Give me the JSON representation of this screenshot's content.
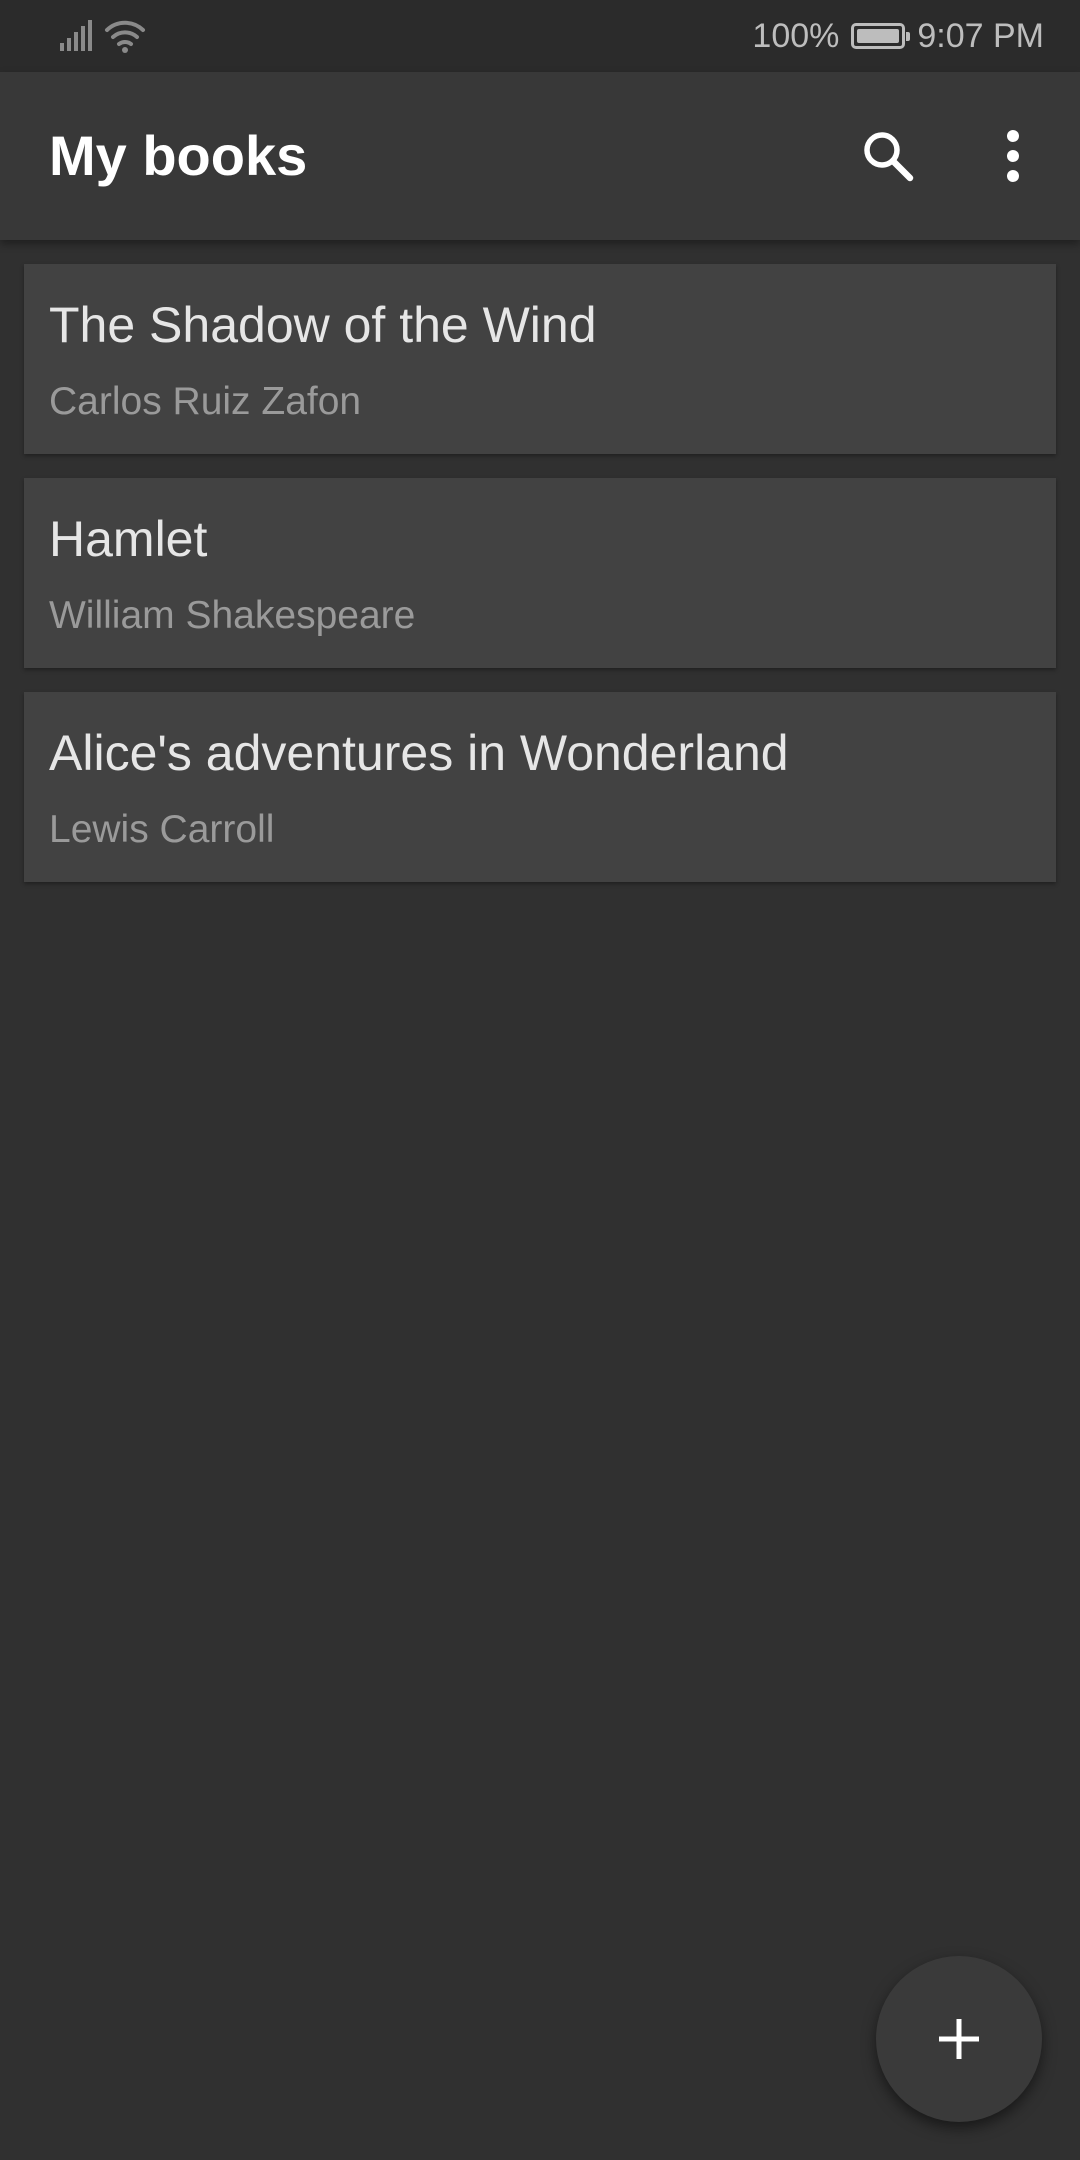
{
  "status_bar": {
    "battery_level": "100%",
    "time": "9:07 PM",
    "battery_fill_fraction": 1.0,
    "signal_icon": "cellular-signal-icon",
    "wifi_icon": "wifi-icon",
    "battery_icon": "battery-icon"
  },
  "app_bar": {
    "title": "My books",
    "search_icon": "search-icon",
    "menu_icon": "more-vert-icon"
  },
  "books": [
    {
      "title": "The Shadow of the Wind",
      "author": "Carlos Ruiz Zafon"
    },
    {
      "title": "Hamlet",
      "author": "William Shakespeare"
    },
    {
      "title": "Alice's adventures in Wonderland",
      "author": "Lewis Carroll"
    }
  ],
  "fab": {
    "icon": "add-icon"
  },
  "colors": {
    "background": "#303030",
    "app_bar": "#383838",
    "card": "#424242",
    "title_text": "#e6e6e6",
    "author_text": "#9a9a9a",
    "icon": "#ffffff"
  }
}
